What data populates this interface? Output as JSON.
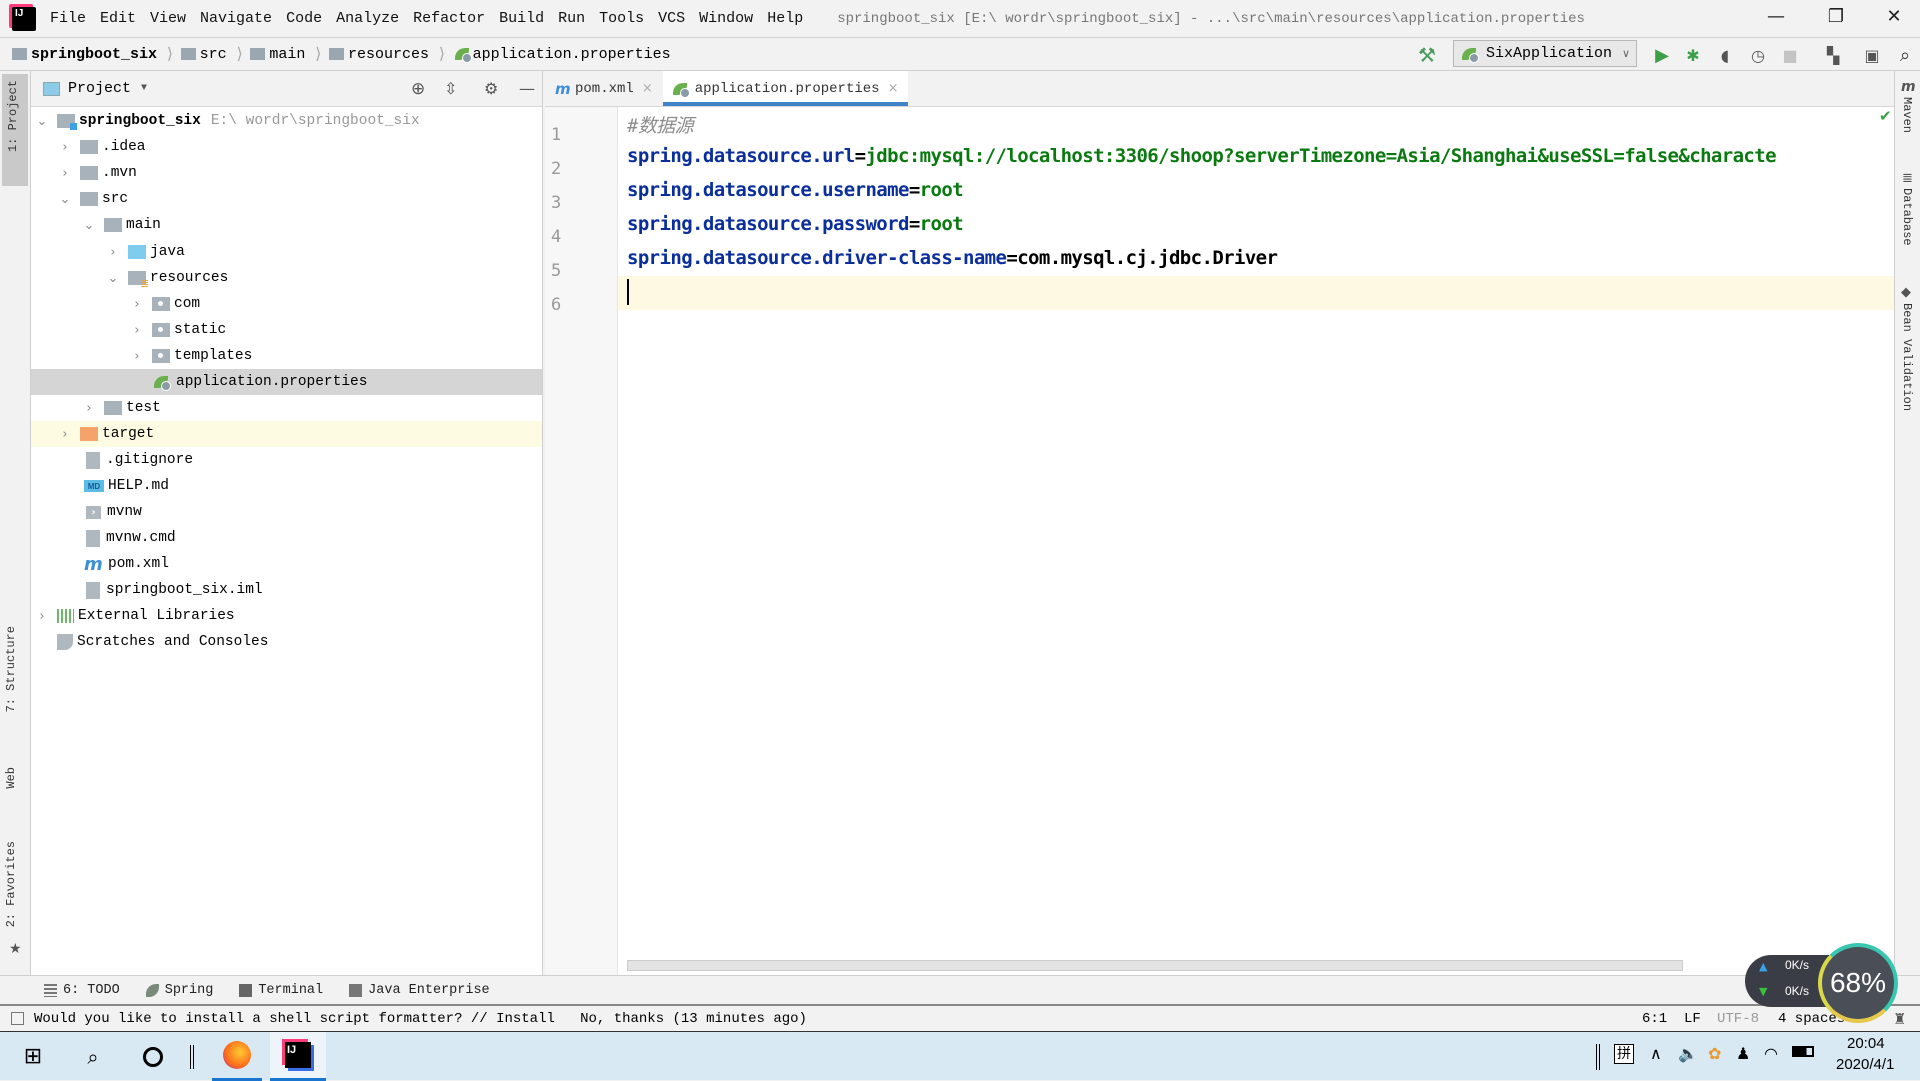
{
  "menubar": {
    "items": [
      "File",
      "Edit",
      "View",
      "Navigate",
      "Code",
      "Analyze",
      "Refactor",
      "Build",
      "Run",
      "Tools",
      "VCS",
      "Window",
      "Help"
    ],
    "title": "springboot_six [E:\\ wordr\\springboot_six] - ...\\src\\main\\resources\\application.properties"
  },
  "window_controls": {
    "minimize": "—",
    "restore": "❐",
    "close": "✕"
  },
  "breadcrumb": [
    "springboot_six",
    "src",
    "main",
    "resources",
    "application.properties"
  ],
  "toolbar": {
    "run_config": "SixApplication"
  },
  "left_strip": {
    "project": "1: Project",
    "structure": "7: Structure",
    "web": "Web",
    "favorites": "2: Favorites"
  },
  "project_panel": {
    "title": "Project",
    "tree": [
      {
        "label": "springboot_six",
        "path": "E:\\ wordr\\springboot_six",
        "arrow": "⌄"
      },
      {
        "label": ".idea",
        "arrow": "›"
      },
      {
        "label": ".mvn",
        "arrow": "›"
      },
      {
        "label": "src",
        "arrow": "⌄"
      },
      {
        "label": "main",
        "arrow": "⌄"
      },
      {
        "label": "java",
        "arrow": "›"
      },
      {
        "label": "resources",
        "arrow": "⌄"
      },
      {
        "label": "com",
        "arrow": "›"
      },
      {
        "label": "static",
        "arrow": "›"
      },
      {
        "label": "templates",
        "arrow": "›"
      },
      {
        "label": "application.properties",
        "arrow": ""
      },
      {
        "label": "test",
        "arrow": "›"
      },
      {
        "label": "target",
        "arrow": "›"
      },
      {
        "label": ".gitignore",
        "arrow": ""
      },
      {
        "label": "HELP.md",
        "arrow": ""
      },
      {
        "label": "mvnw",
        "arrow": ""
      },
      {
        "label": "mvnw.cmd",
        "arrow": ""
      },
      {
        "label": "pom.xml",
        "arrow": ""
      },
      {
        "label": "springboot_six.iml",
        "arrow": ""
      },
      {
        "label": "External Libraries",
        "arrow": "›"
      },
      {
        "label": "Scratches and Consoles",
        "arrow": ""
      }
    ]
  },
  "editor": {
    "tabs": [
      {
        "label": "pom.xml",
        "close": "×"
      },
      {
        "label": "application.properties",
        "close": "×"
      }
    ],
    "line_numbers": [
      "1",
      "2",
      "3",
      "4",
      "5",
      "6"
    ],
    "lines": [
      {
        "comment": "#数据源"
      },
      {
        "key": "spring.datasource.url",
        "eq": "=",
        "value": "jdbc:mysql://localhost:3306/shoop?serverTimezone=Asia/Shanghai&useSSL=false&characte"
      },
      {
        "key": "spring.datasource.username",
        "eq": "=",
        "value": "root"
      },
      {
        "key": "spring.datasource.password",
        "eq": "=",
        "value": "root"
      },
      {
        "key": "spring.datasource.driver-class-name",
        "eq": "=",
        "value": "com.mysql.cj.jdbc.Driver"
      }
    ]
  },
  "right_strip": {
    "maven": "Maven",
    "database": "Database",
    "bean_validation": "Bean Validation"
  },
  "tool_windows": [
    "6: TODO",
    "Spring",
    "Terminal",
    "Java Enterprise"
  ],
  "status_bar": {
    "message": "Would you like to install a shell script formatter? // Install   No, thanks (13 minutes ago)",
    "position": "6:1",
    "line_sep": "LF",
    "encoding": "UTF-8",
    "indent": "4 spaces"
  },
  "net_widget": {
    "up": "0K/s",
    "down": "0K/s",
    "cpu": "68%"
  },
  "taskbar": {
    "ime": "拼",
    "time": "20:04",
    "date": "2020/4/1"
  }
}
